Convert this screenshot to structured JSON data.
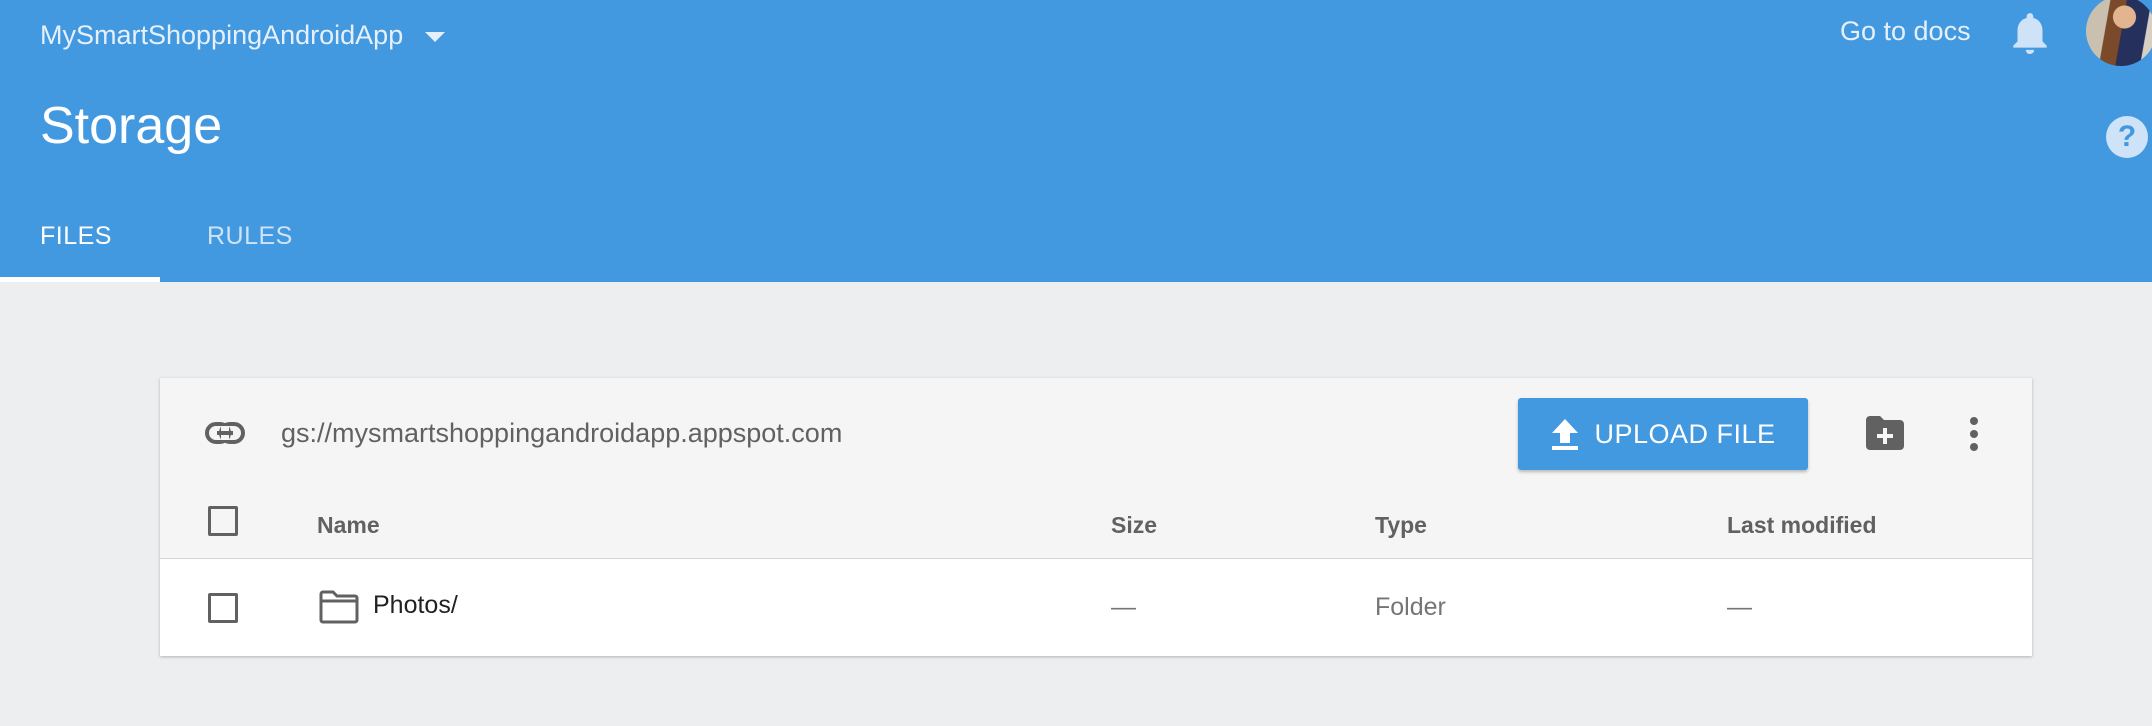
{
  "header": {
    "project_name": "MySmartShoppingAndroidApp",
    "go_to_docs": "Go to docs",
    "page_title": "Storage",
    "help_label": "?",
    "tabs": [
      {
        "label": "FILES",
        "active": true
      },
      {
        "label": "RULES",
        "active": false
      }
    ],
    "colors": {
      "header_bg": "#4399e0",
      "accent": "#4399e0"
    }
  },
  "storage": {
    "bucket_url": "gs://mysmartshoppingandroidapp.appspot.com",
    "upload_label": "UPLOAD FILE",
    "icons": [
      "link-icon",
      "upload-icon",
      "new-folder-icon",
      "more-vert-icon"
    ]
  },
  "table": {
    "columns": [
      "Name",
      "Size",
      "Type",
      "Last modified"
    ],
    "rows": [
      {
        "icon": "folder-icon",
        "name": "Photos/",
        "size": "—",
        "type": "Folder",
        "last_modified": "—"
      }
    ]
  }
}
